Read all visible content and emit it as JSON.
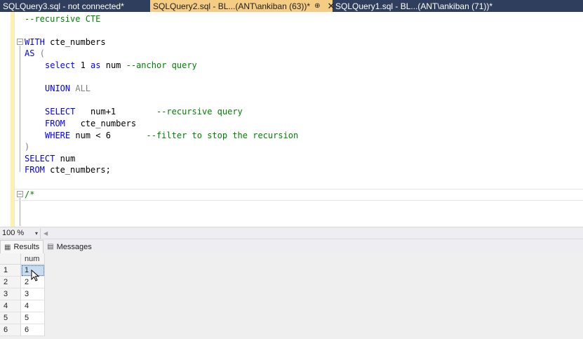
{
  "tabs": [
    {
      "label": "SQLQuery3.sql - not connected*",
      "active": false
    },
    {
      "label": "SQLQuery2.sql - BL...(ANT\\ankiban (63))*",
      "active": true,
      "pin": "⊕",
      "close": "✕"
    },
    {
      "label": "SQLQuery1.sql - BL...(ANT\\ankiban (71))*",
      "active": false
    }
  ],
  "code": {
    "l1": "--recursive CTE",
    "l3_kw": "WITH",
    "l3_rest": " cte_numbers",
    "l4_kw": "AS",
    "l4_paren": " (",
    "l5_kw1": "select",
    "l5_mid": " 1 ",
    "l5_kw2": "as",
    "l5_rest": " num ",
    "l5_cm": "--anchor query",
    "l7_kw": "UNION",
    "l7_gr": " ALL",
    "l9_kw": "SELECT",
    "l9_rest": "   num+1        ",
    "l9_cm": "--recursive query",
    "l10_kw": "FROM",
    "l10_rest": "   cte_numbers",
    "l11_kw": "WHERE",
    "l11_rest": " num < 6       ",
    "l11_cm": "--filter to stop the recursion",
    "l12": ")",
    "l13_kw": "SELECT",
    "l13_rest": " num",
    "l14_kw": "FROM",
    "l14_rest": " cte_numbers;",
    "l16": "/*",
    "fold_minus": "−"
  },
  "zoom": {
    "value": "100 %",
    "dropdown": "▾",
    "scroll": "◀"
  },
  "results_tabs": [
    {
      "label": "Results",
      "icon": "▦",
      "active": true
    },
    {
      "label": "Messages",
      "icon": "▤",
      "active": false
    }
  ],
  "grid": {
    "column": "num",
    "rows": [
      {
        "n": "1",
        "v": "1"
      },
      {
        "n": "2",
        "v": "2"
      },
      {
        "n": "3",
        "v": "3"
      },
      {
        "n": "4",
        "v": "4"
      },
      {
        "n": "5",
        "v": "5"
      },
      {
        "n": "6",
        "v": "6"
      }
    ]
  },
  "colors": {
    "tabbar": "#2f3e5c",
    "active_tab": "#f5cc84",
    "keyword": "#0000ff",
    "comment": "#008000"
  }
}
